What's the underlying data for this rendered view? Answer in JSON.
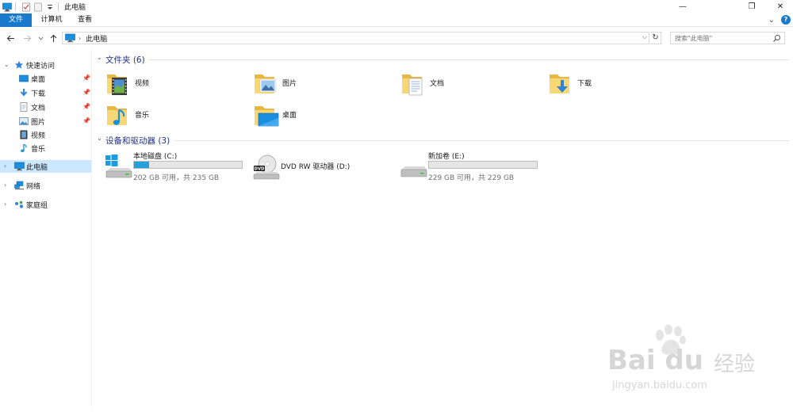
{
  "window": {
    "title": "此电脑",
    "minimize_glyph": "—",
    "restore_glyph": "❐",
    "close_glyph": "✕"
  },
  "ribbon": {
    "tabs": [
      {
        "label": "文件",
        "active": true
      },
      {
        "label": "计算机",
        "active": false
      },
      {
        "label": "查看",
        "active": false
      }
    ],
    "expand_glyph": "⌄",
    "help_glyph": "?"
  },
  "address": {
    "crumbs": [
      "此电脑"
    ],
    "search_placeholder": "搜索\"此电脑\""
  },
  "nav": {
    "quick_access": "快速访问",
    "items": [
      {
        "label": "桌面",
        "icon": "desktop-icon",
        "pinned": true
      },
      {
        "label": "下载",
        "icon": "download-icon",
        "pinned": true
      },
      {
        "label": "文档",
        "icon": "document-icon",
        "pinned": true
      },
      {
        "label": "图片",
        "icon": "picture-icon",
        "pinned": true
      },
      {
        "label": "视频",
        "icon": "video-icon",
        "pinned": false
      },
      {
        "label": "音乐",
        "icon": "music-icon",
        "pinned": false
      }
    ],
    "this_pc": "此电脑",
    "network": "网络",
    "homegroup": "家庭组"
  },
  "folders": {
    "header": "文件夹 (6)",
    "items": [
      {
        "label": "视频",
        "icon": "video-folder-icon"
      },
      {
        "label": "图片",
        "icon": "picture-folder-icon"
      },
      {
        "label": "文档",
        "icon": "document-folder-icon"
      },
      {
        "label": "下载",
        "icon": "download-folder-icon"
      },
      {
        "label": "音乐",
        "icon": "music-folder-icon"
      },
      {
        "label": "桌面",
        "icon": "desktop-folder-icon"
      }
    ]
  },
  "devices": {
    "header": "设备和驱动器 (3)",
    "drives": [
      {
        "name": "本地磁盘 (C:)",
        "free_text": "202 GB 可用，共 235 GB",
        "used_fraction": 0.14,
        "icon": "windows-drive-icon",
        "bar": true
      },
      {
        "name": "DVD RW 驱动器 (D:)",
        "free_text": "",
        "used_fraction": 0,
        "icon": "dvd-drive-icon",
        "bar": false
      },
      {
        "name": "新加卷 (E:)",
        "free_text": "229 GB 可用，共 229 GB",
        "used_fraction": 0.0,
        "icon": "hard-drive-icon",
        "bar": true
      }
    ]
  },
  "watermark": {
    "brand": "Bai du",
    "brand_cn": "经验",
    "url": "jingyan.baidu.com"
  },
  "colors": {
    "accent": "#1979ca",
    "selected": "#cce8ff",
    "group_header": "#1e3287",
    "bar_fill": "#26a0da",
    "folder": "#f8d775"
  }
}
